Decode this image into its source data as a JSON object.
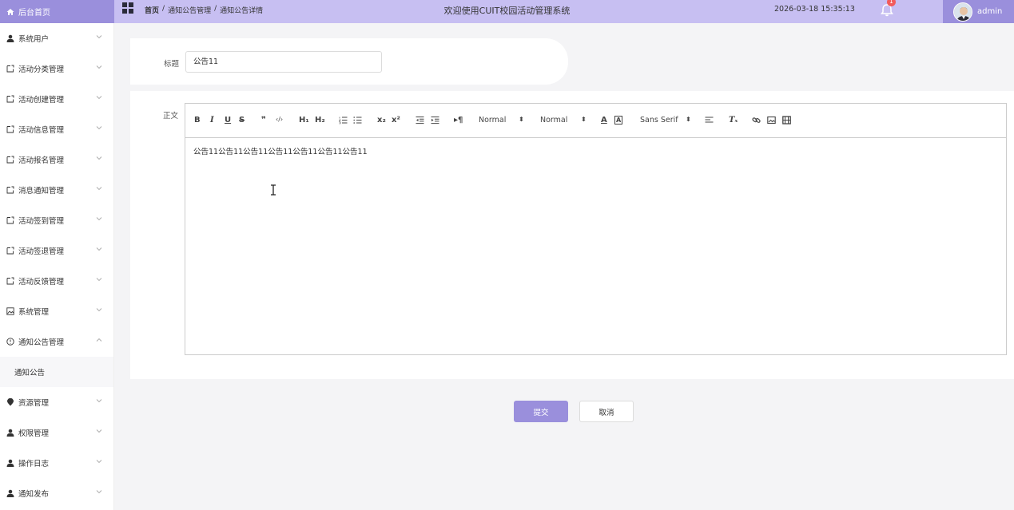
{
  "header": {
    "brand_label": "后台首页",
    "breadcrumb": [
      "首页",
      "/",
      "通知公告管理",
      "/",
      "通知公告详情"
    ],
    "welcome": "欢迎使用CUIT校园活动管理系统",
    "datetime": "2026-03-18 15:35:13",
    "notification_count": "1",
    "username": "admin"
  },
  "sidebar": {
    "items": [
      {
        "label": "系统用户",
        "icon": "user-icon"
      },
      {
        "label": "活动分类管理",
        "icon": "file-icon"
      },
      {
        "label": "活动创建管理",
        "icon": "file-icon"
      },
      {
        "label": "活动信息管理",
        "icon": "file-icon"
      },
      {
        "label": "活动报名管理",
        "icon": "file-icon"
      },
      {
        "label": "消息通知管理",
        "icon": "file-icon"
      },
      {
        "label": "活动签到管理",
        "icon": "file-icon"
      },
      {
        "label": "活动签退管理",
        "icon": "file-icon"
      },
      {
        "label": "活动反馈管理",
        "icon": "file-icon"
      },
      {
        "label": "系统管理",
        "icon": "picture-icon"
      },
      {
        "label": "通知公告管理",
        "icon": "info-icon"
      },
      {
        "label": "通知公告",
        "icon": ""
      },
      {
        "label": "资源管理",
        "icon": "location-icon"
      },
      {
        "label": "权限管理",
        "icon": "user-icon"
      },
      {
        "label": "操作日志",
        "icon": "user-icon"
      },
      {
        "label": "通知发布",
        "icon": "user-icon"
      }
    ]
  },
  "form": {
    "title_label": "标题",
    "title_value": "公告11",
    "body_label": "正文",
    "body_content": "公告11公告11公告11公告11公告11公告11公告11"
  },
  "toolbar": {
    "bold": "B",
    "italic": "I",
    "underline": "U",
    "strike": "S",
    "quote": "❞",
    "code": "‹/›",
    "h1": "H₁",
    "h2": "H₂",
    "sub": "x₂",
    "sup": "x²",
    "rtl": "▸¶",
    "size_select": "Normal",
    "header_select": "Normal",
    "font_select": "Sans Serif",
    "clean": "Tₓ"
  },
  "actions": {
    "submit": "提交",
    "cancel": "取消"
  },
  "colors": {
    "accent": "#9a8fdc",
    "header_bg": "#c7bff2"
  }
}
